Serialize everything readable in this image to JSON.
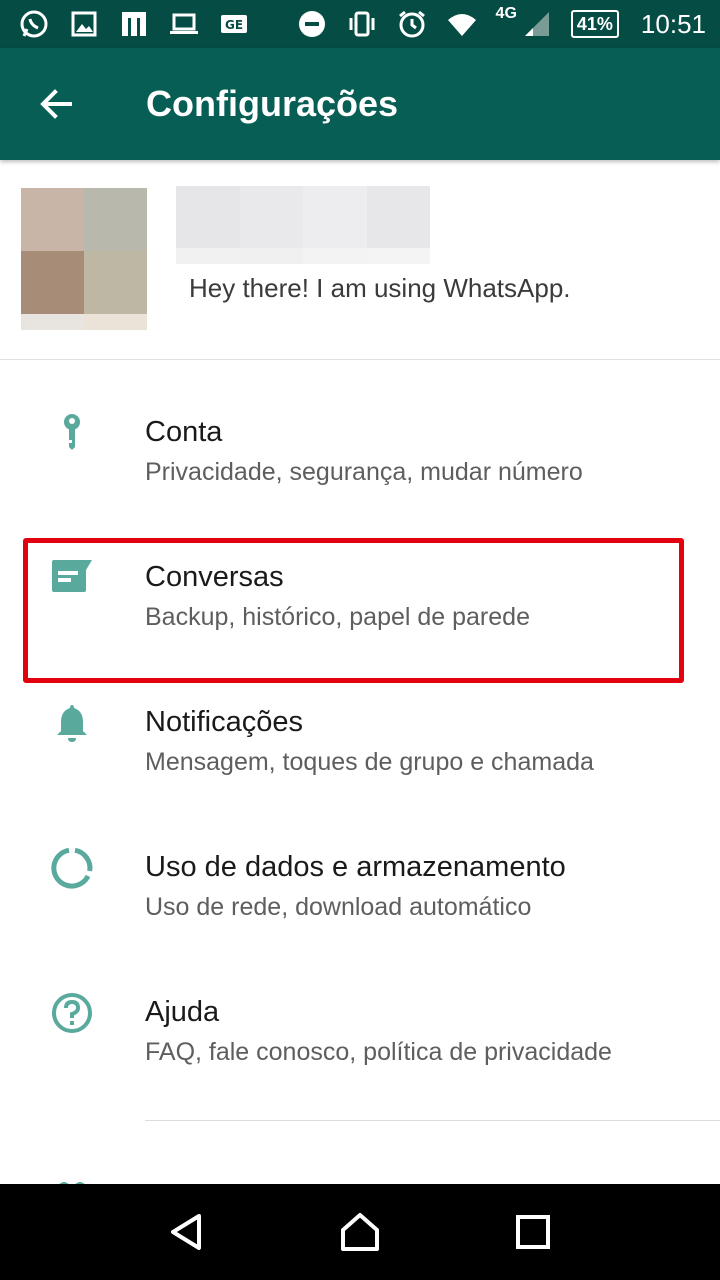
{
  "status_bar": {
    "battery": "41%",
    "time": "10:51",
    "network": "4G",
    "icons": [
      "whatsapp-icon",
      "image-icon",
      "metro-icon",
      "laptop-icon",
      "ge-icon",
      "dnd-icon",
      "vibrate-icon",
      "alarm-icon",
      "wifi-icon",
      "signal-icon",
      "battery-icon"
    ]
  },
  "app_bar": {
    "title": "Configurações",
    "back_icon": "arrow-back-icon"
  },
  "profile": {
    "status": "Hey there! I am using WhatsApp.",
    "avatar_colors": [
      "#c9b5a8",
      "#b9b8ad",
      "#a78c78",
      "#beb7a3",
      "#e8e4e0",
      "#ebe3d8"
    ],
    "name_blur_colors": [
      "#e6e6e8",
      "#e9e9eb",
      "#ededef",
      "#e7e7e9"
    ]
  },
  "settings": [
    {
      "title": "Conta",
      "subtitle": "Privacidade, segurança, mudar número",
      "icon": "key-icon"
    },
    {
      "title": "Conversas",
      "subtitle": "Backup, histórico, papel de parede",
      "icon": "chat-icon"
    },
    {
      "title": "Notificações",
      "subtitle": "Mensagem, toques de grupo e chamada",
      "icon": "bell-icon"
    },
    {
      "title": "Uso de dados e armazenamento",
      "subtitle": "Uso de rede, download automático",
      "icon": "data-usage-icon"
    },
    {
      "title": "Ajuda",
      "subtitle": "FAQ, fale conosco, política de privacidade",
      "icon": "help-icon"
    }
  ],
  "colors": {
    "status_bar": "#054d44",
    "app_bar": "#075e54",
    "icon_accent": "#5aa99d",
    "highlight": "#e3000f"
  },
  "nav_bar": {
    "icons": [
      "back-triangle-icon",
      "home-icon",
      "recents-icon"
    ]
  }
}
